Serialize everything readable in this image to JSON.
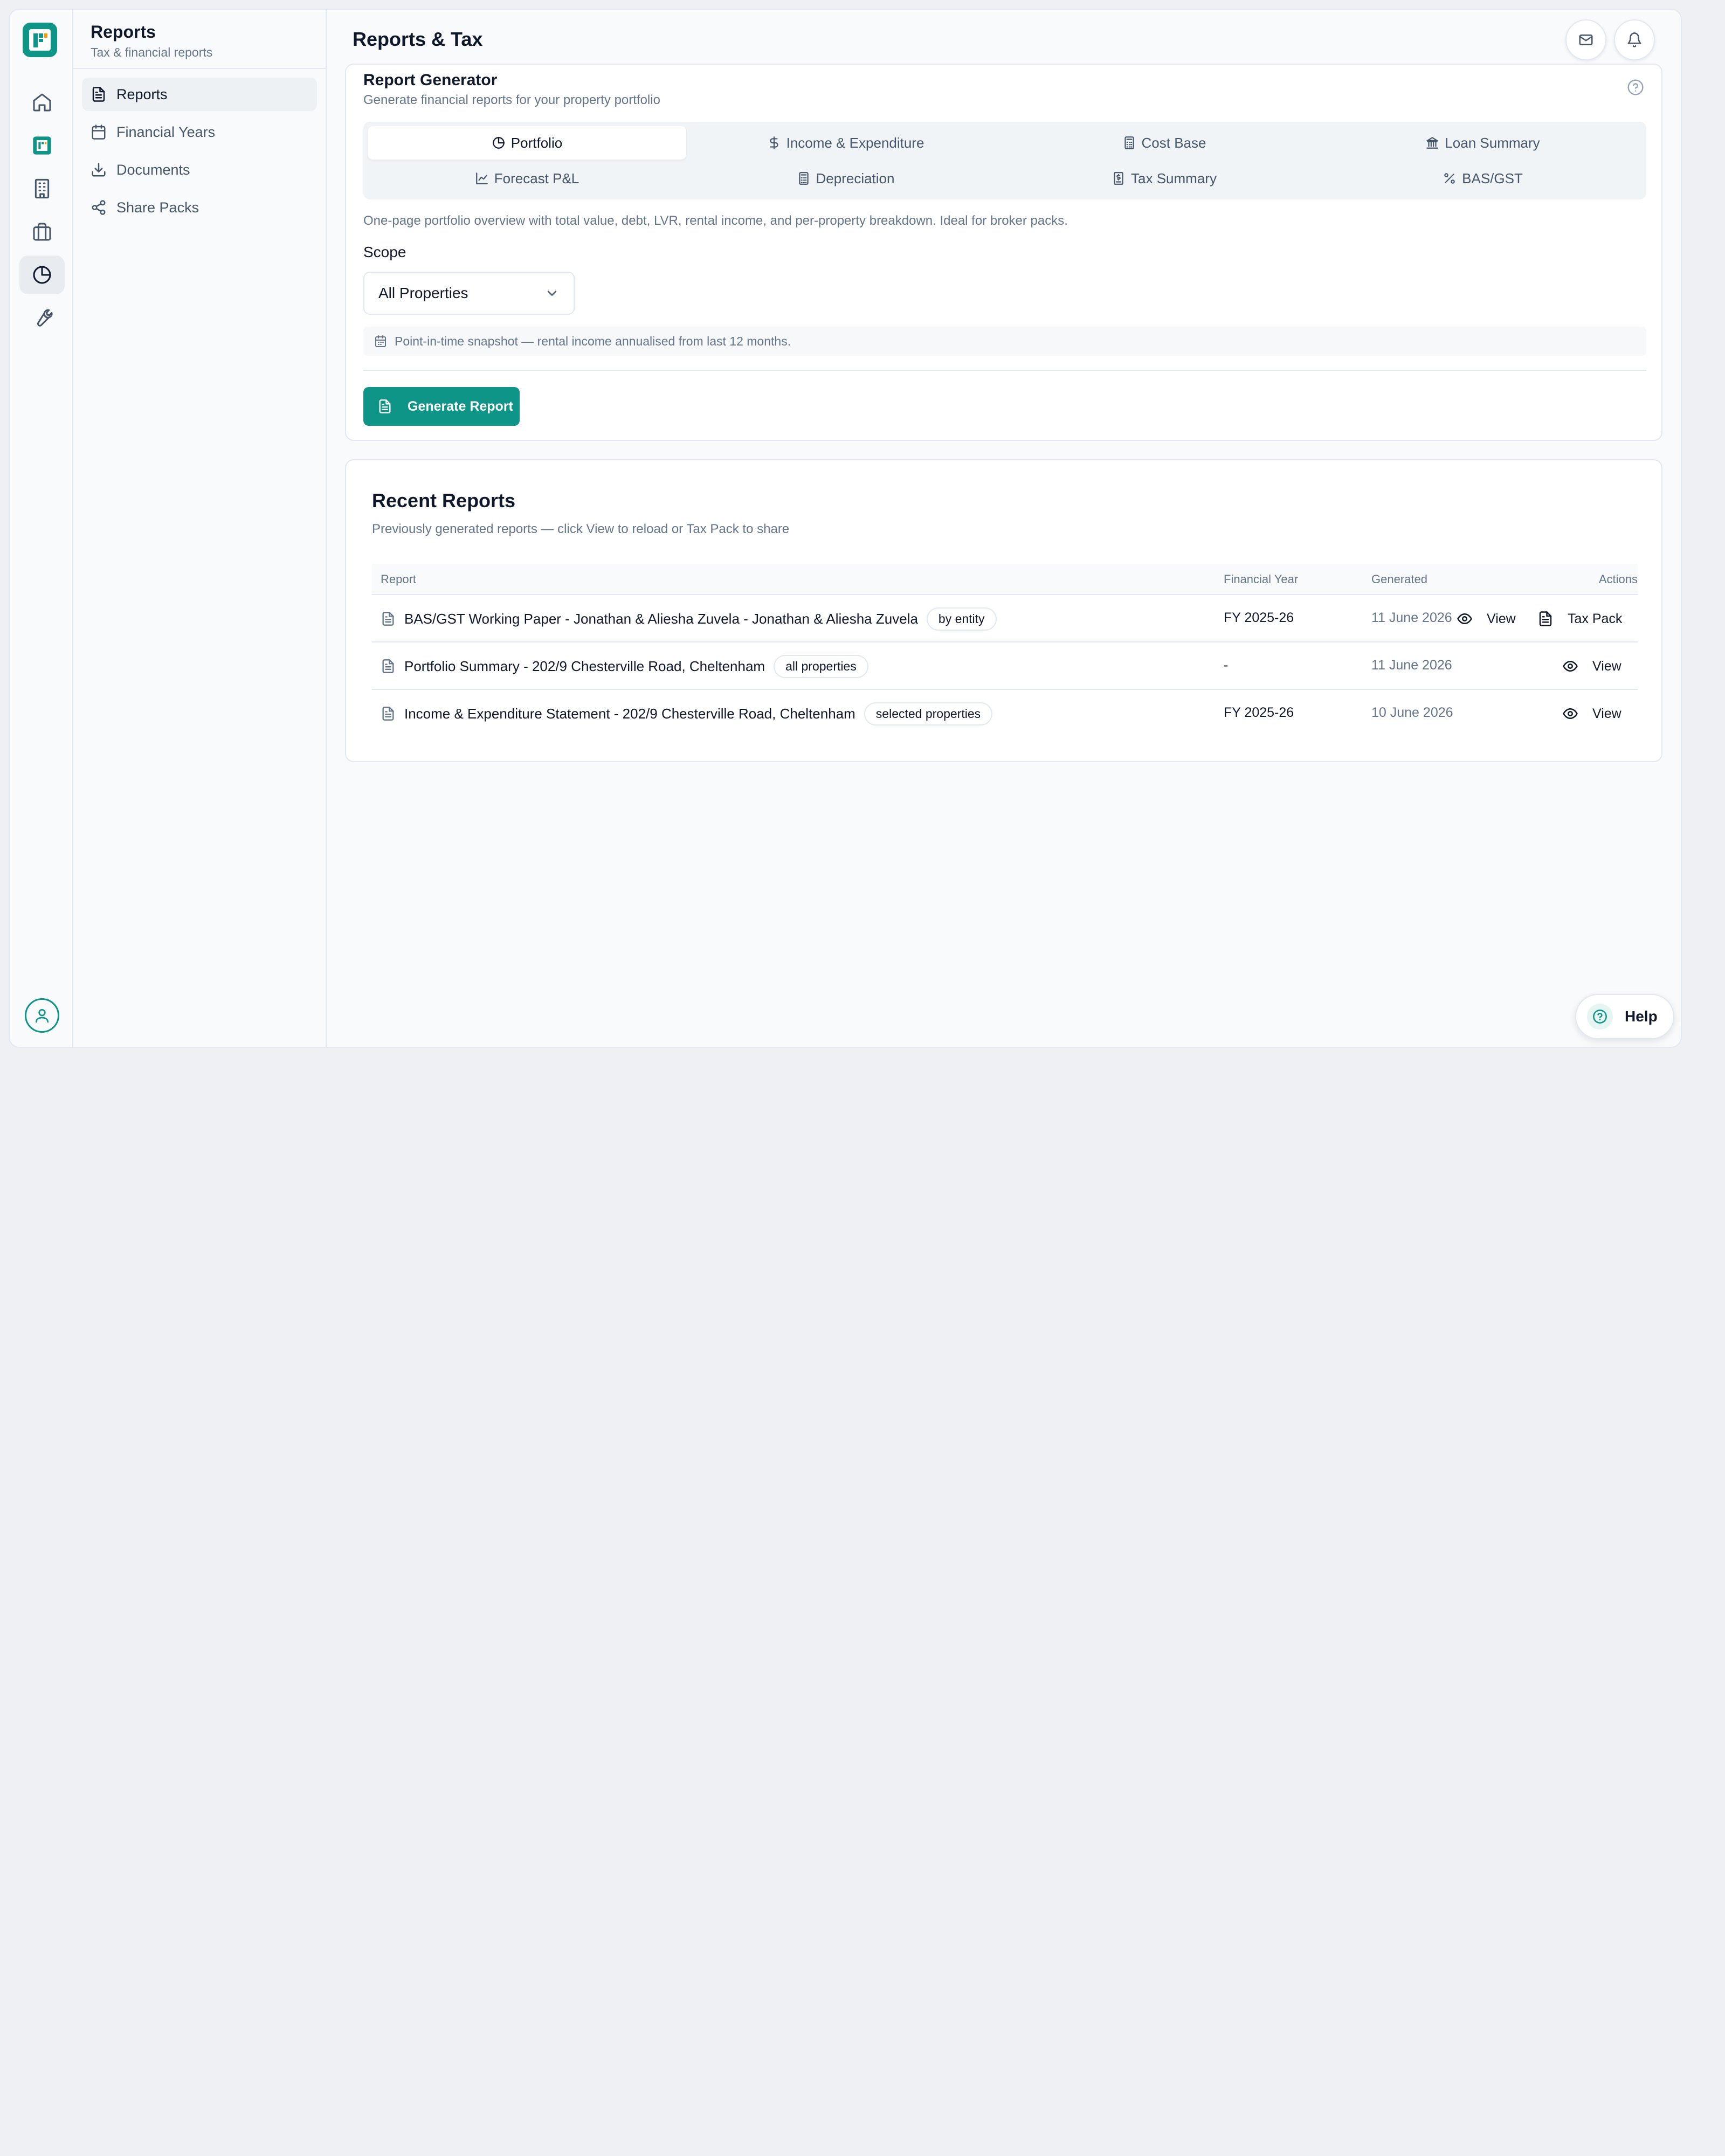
{
  "rail": {
    "logo": "app-logo",
    "items": [
      {
        "icon": "home-icon"
      },
      {
        "icon": "app-logo-icon"
      },
      {
        "icon": "building-icon"
      },
      {
        "icon": "briefcase-icon"
      },
      {
        "icon": "pie-chart-icon",
        "active": true
      },
      {
        "icon": "wrench-icon"
      }
    ],
    "avatar_icon": "user-icon"
  },
  "subnav": {
    "title": "Reports",
    "subtitle": "Tax & financial reports",
    "items": [
      {
        "label": "Reports",
        "icon": "file-text-icon",
        "active": true
      },
      {
        "label": "Financial Years",
        "icon": "calendar-icon"
      },
      {
        "label": "Documents",
        "icon": "download-icon"
      },
      {
        "label": "Share Packs",
        "icon": "share-icon"
      }
    ]
  },
  "header": {
    "title": "Reports & Tax",
    "icons": [
      "mail-icon",
      "bell-icon"
    ]
  },
  "generator": {
    "title": "Report Generator",
    "subtitle": "Generate financial reports for your property portfolio",
    "tabs": [
      {
        "label": "Portfolio",
        "icon": "pie-chart-icon",
        "active": true
      },
      {
        "label": "Income & Expenditure",
        "icon": "dollar-icon"
      },
      {
        "label": "Cost Base",
        "icon": "calculator-icon"
      },
      {
        "label": "Loan Summary",
        "icon": "bank-icon"
      },
      {
        "label": "Forecast P&L",
        "icon": "line-chart-icon"
      },
      {
        "label": "Depreciation",
        "icon": "calculator-icon"
      },
      {
        "label": "Tax Summary",
        "icon": "receipt-icon"
      },
      {
        "label": "BAS/GST",
        "icon": "percent-icon"
      }
    ],
    "description": "One-page portfolio overview with total value, debt, LVR, rental income, and per-property breakdown. Ideal for broker packs.",
    "scope_label": "Scope",
    "scope_value": "All Properties",
    "snapshot_note": "Point-in-time snapshot — rental income annualised from last 12 months.",
    "button_label": "Generate Report"
  },
  "recent": {
    "title": "Recent Reports",
    "subtitle": "Previously generated reports — click View to reload or Tax Pack to share",
    "columns": [
      "Report",
      "Financial Year",
      "Generated",
      "Actions"
    ],
    "rows": [
      {
        "report": "BAS/GST Working Paper - Jonathan & Aliesha Zuvela - Jonathan & Aliesha Zuvela",
        "badge": "by entity",
        "fy": "FY 2025-26",
        "generated": "11 June 2026",
        "view": "View",
        "taxpack": "Tax Pack"
      },
      {
        "report": "Portfolio Summary - 202/9 Chesterville Road, Cheltenham",
        "badge": "all properties",
        "fy": "-",
        "generated": "11 June 2026",
        "view": "View"
      },
      {
        "report": "Income & Expenditure Statement - 202/9 Chesterville Road, Cheltenham",
        "badge": "selected properties",
        "fy": "FY 2025-26",
        "generated": "10 June 2026",
        "view": "View"
      }
    ]
  },
  "help_button": "Help",
  "colors": {
    "accent": "#0f9488",
    "text": "#0f172a",
    "muted": "#64748b",
    "border": "#e2e8f0"
  }
}
